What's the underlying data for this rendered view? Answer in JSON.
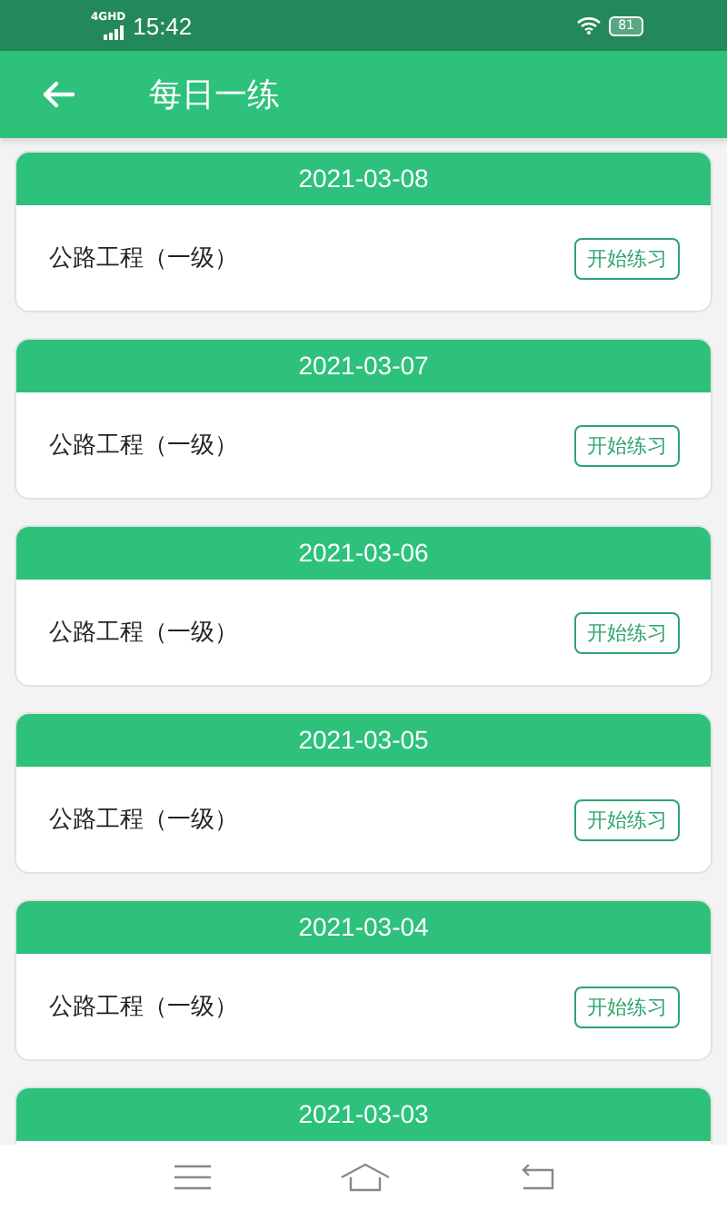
{
  "status_bar": {
    "network": "4GHD",
    "time": "15:42",
    "battery": "81"
  },
  "app_bar": {
    "title": "每日一练"
  },
  "practices": [
    {
      "date": "2021-03-08",
      "subject": "公路工程（一级）",
      "button": "开始练习"
    },
    {
      "date": "2021-03-07",
      "subject": "公路工程（一级）",
      "button": "开始练习"
    },
    {
      "date": "2021-03-06",
      "subject": "公路工程（一级）",
      "button": "开始练习"
    },
    {
      "date": "2021-03-05",
      "subject": "公路工程（一级）",
      "button": "开始练习"
    },
    {
      "date": "2021-03-04",
      "subject": "公路工程（一级）",
      "button": "开始练习"
    },
    {
      "date": "2021-03-03"
    }
  ]
}
